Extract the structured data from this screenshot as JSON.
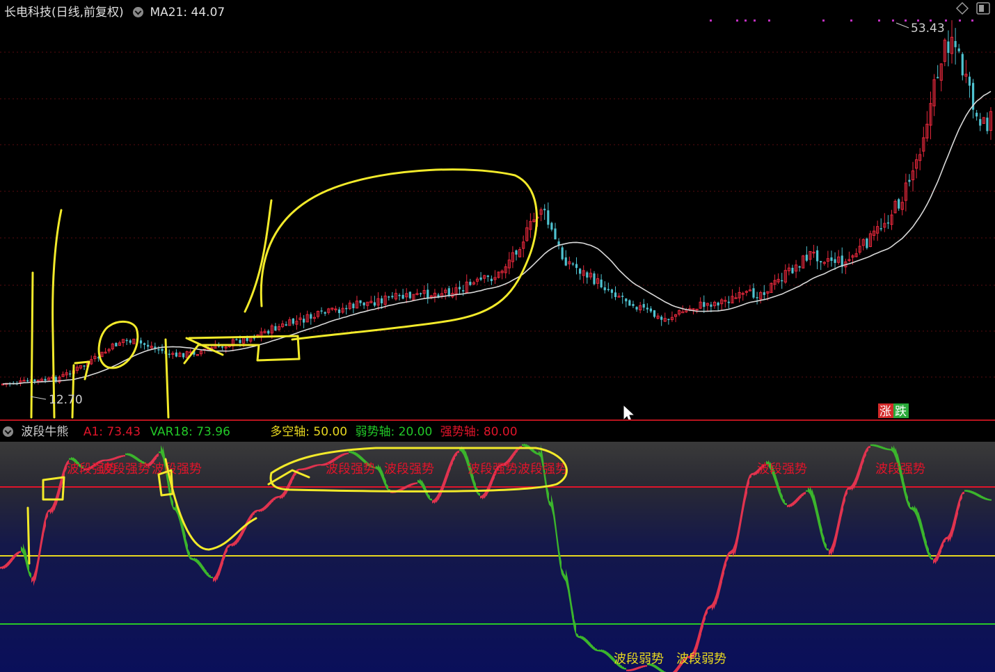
{
  "main": {
    "title": "长电科技(日线,前复权)",
    "ma_label": "MA21: 44.07",
    "high_label": "53.43",
    "low_label": "12.70",
    "rise_label": "涨",
    "fall_label": "跌"
  },
  "indicator": {
    "name": "波段牛熊",
    "a1": "A1: 73.43",
    "var18": "VAR18: 73.96",
    "duokong": "多空轴: 50.00",
    "weak_axis": "弱势轴: 20.00",
    "strong_axis": "强势轴: 80.00",
    "strong_text": "波段强势",
    "weak_text": "波段弱势",
    "levels": {
      "strong": 80,
      "mid": 50,
      "weak": 20
    }
  },
  "colors": {
    "up": "#e8283c",
    "down": "#4fc2d0",
    "ma": "#d8d8d8",
    "annotation": "#f2ea2a",
    "osc_up": "#e0334f",
    "osc_down": "#3bb52c",
    "strong_line": "#e0142a",
    "mid_line": "#e8d820",
    "weak_line": "#28c828"
  },
  "icons": {
    "settings": "chevron-circle-icon",
    "diamond": "diamond-icon",
    "window": "window-icon",
    "cursor": "cursor-arrow-icon"
  }
}
